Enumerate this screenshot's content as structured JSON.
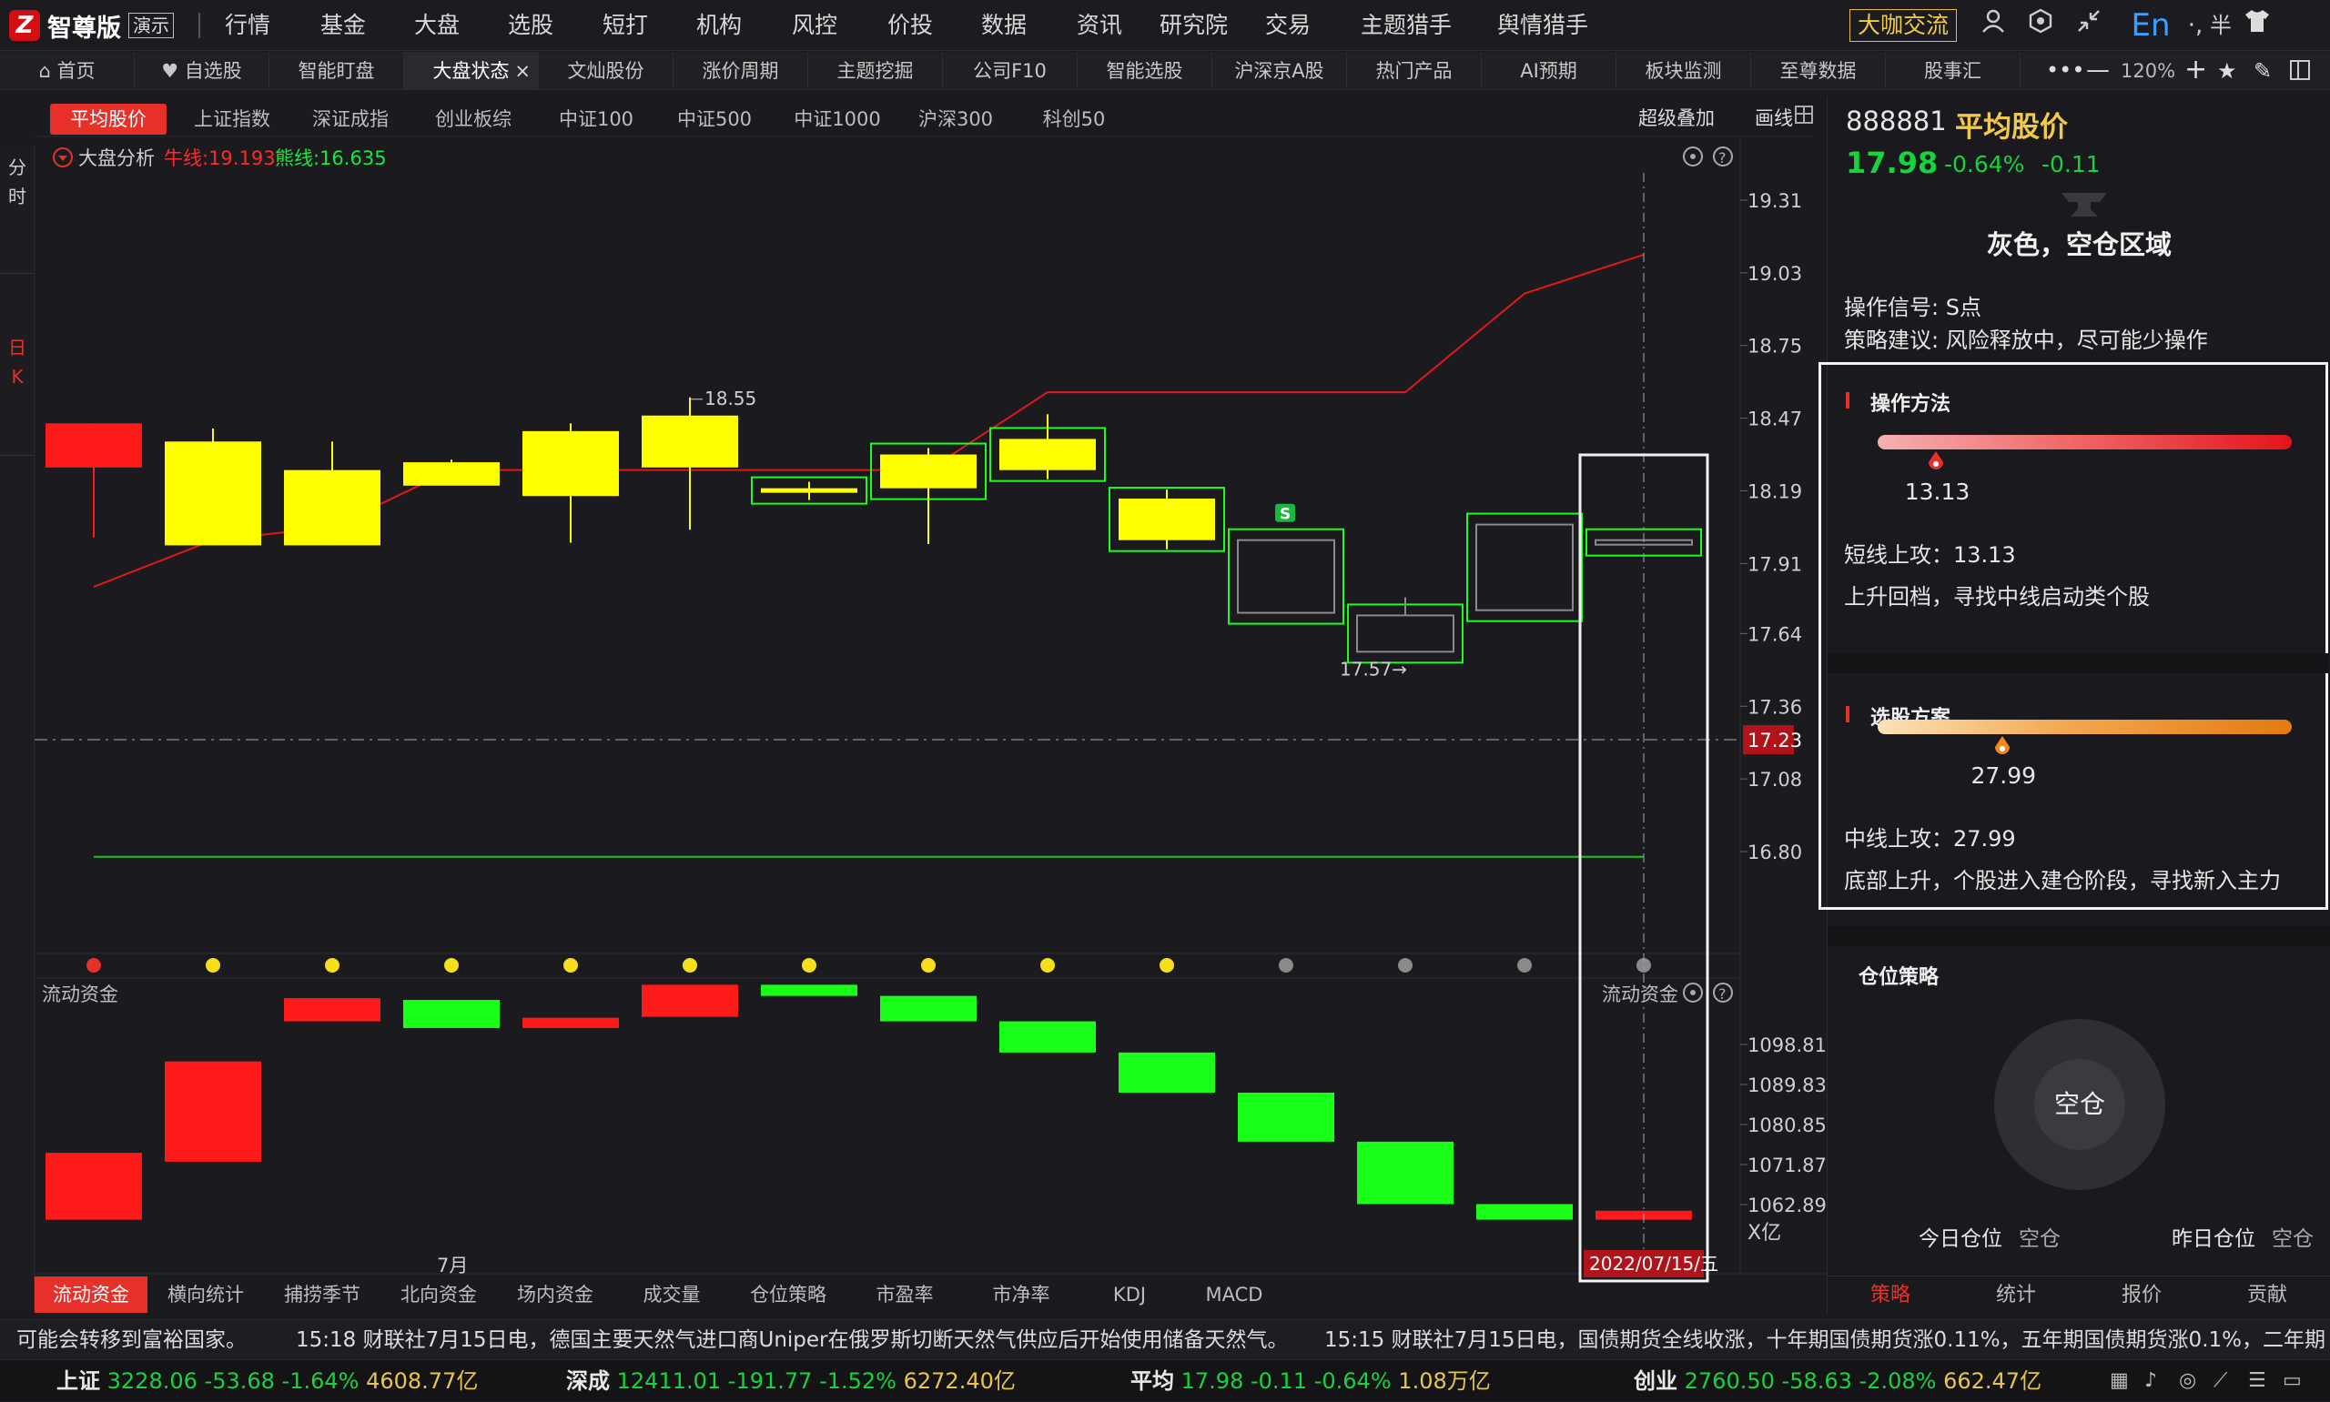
{
  "app": {
    "mark": "Z",
    "name": "智尊版",
    "demo": "演示"
  },
  "main_nav": [
    "行情",
    "基金",
    "大盘",
    "选股",
    "短打",
    "机构",
    "风控",
    "价投",
    "数据",
    "资讯",
    "研究院",
    "交易",
    "主题猎手",
    "舆情猎手"
  ],
  "top_right": {
    "dakaj": "大咖交流",
    "lang": "En"
  },
  "tabs": [
    "首页",
    "自选股",
    "智能盯盘",
    "大盘状态",
    "文灿股份",
    "涨价周期",
    "主题挖掘",
    "公司F10",
    "智能选股",
    "沪深京A股",
    "热门产品",
    "AI预期",
    "板块监测",
    "至尊数据",
    "股事汇"
  ],
  "active_tab_index": 3,
  "zoom": "120%",
  "index_tabs": [
    "平均股价",
    "上证指数",
    "深证成指",
    "创业板综",
    "中证100",
    "中证500",
    "中证1000",
    "沪深300",
    "科创50"
  ],
  "chart_tools": {
    "overlay": "超级叠加",
    "draw": "画线"
  },
  "left_strip": {
    "fen": "分",
    "shi": "时",
    "ri": "日",
    "k": "K"
  },
  "analysis": {
    "label": "大盘分析",
    "bull_label": "牛线:19.193",
    "bear_label": "熊线:16.635"
  },
  "colors": {
    "up": "#ff1a1a",
    "yellow": "#ffff00",
    "green": "#19ff19",
    "bull": "#e01818",
    "bear": "#18c818",
    "gray": "#8a8a8a"
  },
  "chart_data": {
    "type": "candlestick",
    "y_ticks": [
      "19.31",
      "19.03",
      "18.75",
      "18.47",
      "18.19",
      "17.91",
      "17.64",
      "17.36",
      "17.08",
      "16.80"
    ],
    "y_tick_values": [
      19.31,
      19.03,
      18.75,
      18.47,
      18.19,
      17.91,
      17.64,
      17.36,
      17.08,
      16.8
    ],
    "current_price_tag": "17.23",
    "high_label": "18.55",
    "low_label": "17.57",
    "candles": [
      {
        "o": 18.28,
        "h": 18.45,
        "l": 18.01,
        "c": 18.45,
        "style": "red"
      },
      {
        "o": 17.98,
        "h": 18.43,
        "l": 17.98,
        "c": 18.38,
        "style": "yellow"
      },
      {
        "o": 17.98,
        "h": 18.38,
        "l": 17.98,
        "c": 18.27,
        "style": "yellow"
      },
      {
        "o": 18.21,
        "h": 18.31,
        "l": 18.21,
        "c": 18.3,
        "style": "yellow"
      },
      {
        "o": 18.17,
        "h": 18.45,
        "l": 17.99,
        "c": 18.42,
        "style": "yellow"
      },
      {
        "o": 18.28,
        "h": 18.55,
        "l": 18.04,
        "c": 18.48,
        "style": "yellow"
      },
      {
        "o": 18.2,
        "h": 18.19,
        "l": 18.19,
        "c": 18.19,
        "style": "green-yellow"
      },
      {
        "o": 18.2,
        "h": 18.32,
        "l": 18.02,
        "c": 18.33,
        "style": "green-yellow"
      },
      {
        "o": 18.27,
        "h": 18.45,
        "l": 18.27,
        "c": 18.39,
        "style": "green-yellow"
      },
      {
        "o": 18.0,
        "h": 18.16,
        "l": 18.0,
        "c": 18.16,
        "style": "green-yellow"
      },
      {
        "o": 17.72,
        "h": 18.0,
        "l": 17.72,
        "c": 18.0,
        "style": "green-hollow"
      },
      {
        "o": 17.57,
        "h": 17.78,
        "l": 17.62,
        "c": 17.71,
        "style": "green-hollow"
      },
      {
        "o": 17.73,
        "h": 18.06,
        "l": 17.73,
        "c": 18.06,
        "style": "green-hollow"
      },
      {
        "o": 18.0,
        "h": 18.0,
        "l": 18.0,
        "c": 18.0,
        "style": "green-hollow"
      }
    ],
    "bull_line": [
      17.82,
      18.0,
      18.05,
      18.27,
      18.27,
      18.27,
      18.27,
      18.27,
      18.57,
      18.57,
      18.57,
      18.57,
      18.95,
      19.1
    ],
    "bear_line": 16.78,
    "signal_dots": [
      "red",
      "yellow",
      "yellow",
      "yellow",
      "yellow",
      "yellow",
      "yellow",
      "yellow",
      "yellow",
      "yellow",
      "gray",
      "gray",
      "gray",
      "gray"
    ],
    "s_marker_index": 10,
    "s_marker": "S",
    "x_label": "7月",
    "x_label_index": 3,
    "date_tag": "2022/07/15/五",
    "flow": {
      "title": "流动资金",
      "y_ticks": [
        "1098.81",
        "1089.83",
        "1080.85",
        "1071.87",
        "1062.89"
      ],
      "y_tick_values": [
        1098.81,
        1089.83,
        1080.85,
        1071.87,
        1062.89
      ],
      "unit": "X亿",
      "bars": [
        {
          "from": 1059.5,
          "to": 1074.5,
          "color": "red"
        },
        {
          "from": 1072.5,
          "to": 1095.0,
          "color": "red"
        },
        {
          "from": 1104.0,
          "to": 1109.2,
          "color": "red"
        },
        {
          "from": 1102.5,
          "to": 1108.8,
          "color": "green"
        },
        {
          "from": 1102.5,
          "to": 1104.8,
          "color": "red"
        },
        {
          "from": 1105.0,
          "to": 1112.2,
          "color": "red"
        },
        {
          "from": 1109.7,
          "to": 1112.2,
          "color": "green"
        },
        {
          "from": 1104.0,
          "to": 1109.7,
          "color": "green"
        },
        {
          "from": 1097.0,
          "to": 1104.0,
          "color": "green"
        },
        {
          "from": 1088.0,
          "to": 1097.0,
          "color": "green"
        },
        {
          "from": 1077.0,
          "to": 1088.0,
          "color": "green"
        },
        {
          "from": 1063.0,
          "to": 1077.0,
          "color": "green"
        },
        {
          "from": 1059.5,
          "to": 1063.0,
          "color": "green"
        },
        {
          "from": 1059.5,
          "to": 1061.5,
          "color": "red"
        }
      ]
    }
  },
  "bottom_tabs": [
    "流动资金",
    "横向统计",
    "捕捞季节",
    "北向资金",
    "场内资金",
    "成交量",
    "仓位策略",
    "市盈率",
    "市净率",
    "KDJ",
    "MACD"
  ],
  "panel": {
    "code": "888881",
    "name": "平均股价",
    "price": "17.98",
    "pct": "-0.64%",
    "chg": "-0.11",
    "zone": "灰色，空仓区域",
    "signal": "操作信号: S点",
    "advice": "策略建议: 风险释放中，尽可能少操作",
    "method_title": "操作方法",
    "method_value": "13.13",
    "method_fraction": 0.14,
    "method_line": "短线上攻：13.13",
    "method_desc": "上升回档，寻找中线启动类个股",
    "pick_title": "选股方案",
    "pick_value": "27.99",
    "pick_fraction": 0.3,
    "pick_line": "中线上攻：27.99",
    "pick_desc": "底部上升，个股进入建仓阶段，寻找新入主力",
    "pos_title": "仓位策略",
    "pos_center": "空仓",
    "today_label": "今日仓位",
    "today_value": "空仓",
    "yest_label": "昨日仓位",
    "yest_value": "空仓",
    "tabs": [
      "策略",
      "统计",
      "报价",
      "贡献"
    ]
  },
  "ticker": {
    "t1": "可能会转移到富裕国家。",
    "t2": "15:18 财联社7月15日电，德国主要天然气进口商Uniper在俄罗斯切断天然气供应后开始使用储备天然气。",
    "t3": "15:15 财联社7月15日电，国债期货全线收涨，十年期国债期货涨0.11%，五年期国债期货涨0.1%，二年期"
  },
  "status": [
    {
      "name": "上证",
      "val": "3228.06",
      "chg": "-53.68",
      "pct": "-1.64%",
      "amt": "4608.77亿"
    },
    {
      "name": "深成",
      "val": "12411.01",
      "chg": "-191.77",
      "pct": "-1.52%",
      "amt": "6272.40亿"
    },
    {
      "name": "平均",
      "val": "17.98",
      "chg": "-0.11",
      "pct": "-0.64%",
      "amt": "1.08万亿"
    },
    {
      "name": "创业",
      "val": "2760.50",
      "chg": "-58.63",
      "pct": "-2.08%",
      "amt": "662.47亿"
    }
  ]
}
